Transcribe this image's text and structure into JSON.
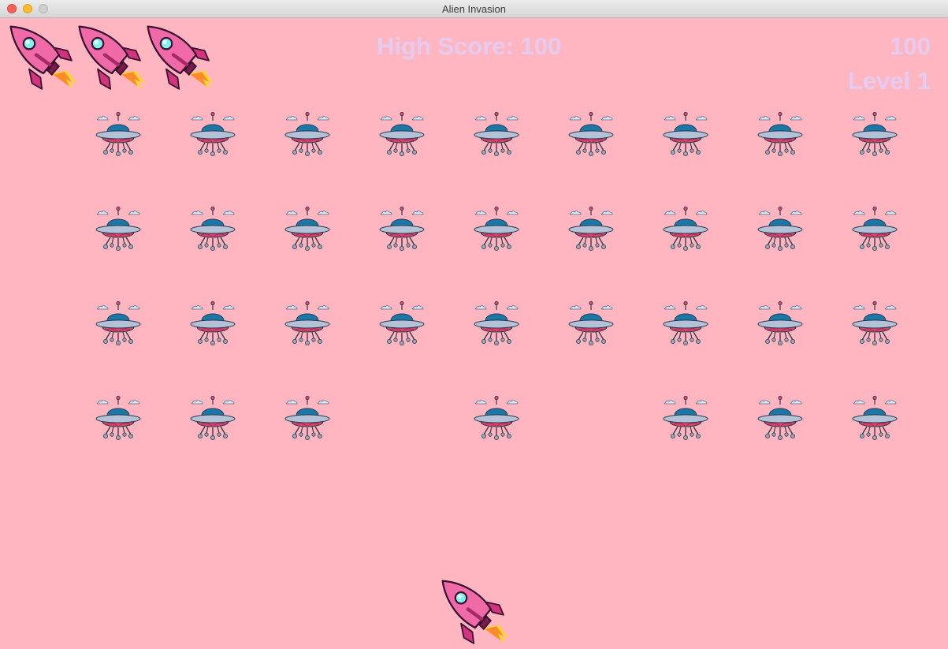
{
  "window": {
    "title": "Alien Invasion"
  },
  "hud": {
    "high_score_label": "High Score: 100",
    "score": "100",
    "level_label": "Level 1"
  },
  "lives_remaining": 3,
  "alien_fleet": {
    "columns": 9,
    "rows": 4,
    "grid": [
      [
        1,
        1,
        1,
        1,
        1,
        1,
        1,
        1,
        1
      ],
      [
        1,
        1,
        1,
        1,
        1,
        1,
        1,
        1,
        1
      ],
      [
        1,
        1,
        1,
        1,
        1,
        1,
        1,
        1,
        1
      ],
      [
        1,
        1,
        1,
        0,
        1,
        0,
        1,
        1,
        1
      ]
    ]
  },
  "icons": {
    "ship": "rocket-icon",
    "alien": "ufo-icon"
  },
  "colors": {
    "background": "#ffb6c1",
    "hud_text": "#e6cbef",
    "rocket_body": "#f06aa8",
    "ufo_dome": "#1a78a8",
    "ufo_base": "#d9456f"
  }
}
